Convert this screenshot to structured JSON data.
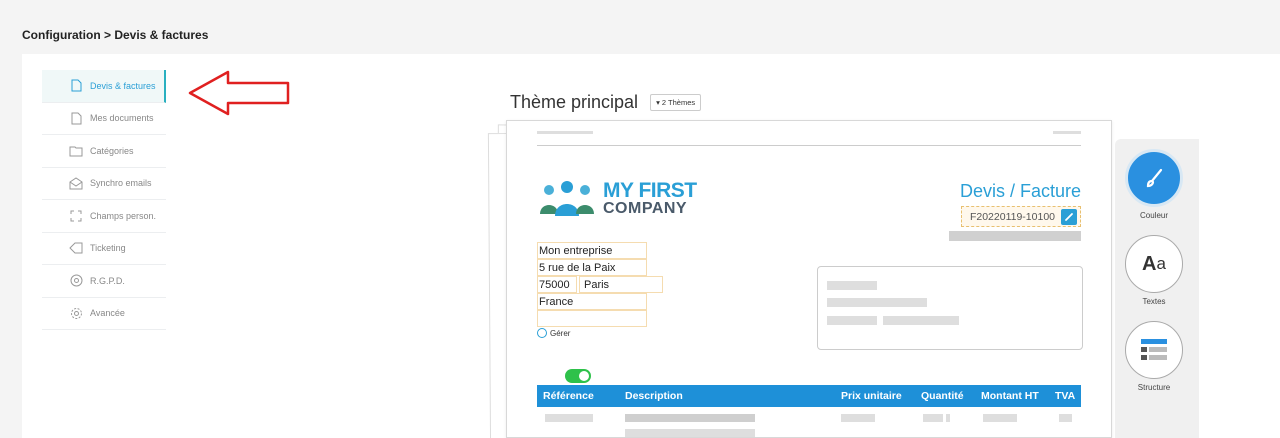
{
  "breadcrumb": "Configuration > Devis & factures",
  "sidebar": {
    "items": [
      {
        "label": "Devis & factures",
        "icon": "document-icon",
        "active": true
      },
      {
        "label": "Mes documents",
        "icon": "document-icon",
        "active": false
      },
      {
        "label": "Catégories",
        "icon": "folder-icon",
        "active": false
      },
      {
        "label": "Synchro emails",
        "icon": "email-icon",
        "active": false
      },
      {
        "label": "Champs person.",
        "icon": "expand-icon",
        "active": false
      },
      {
        "label": "Ticketing",
        "icon": "tag-icon",
        "active": false
      },
      {
        "label": "R.G.P.D.",
        "icon": "shield-icon",
        "active": false
      },
      {
        "label": "Avancée",
        "icon": "gear-icon",
        "active": false
      }
    ]
  },
  "theme": {
    "title": "Thème principal",
    "selector_label": "▾ 2 Thèmes"
  },
  "document": {
    "logo_line1": "MY FIRST",
    "logo_line2": "COMPANY",
    "title": "Devis / Facture",
    "number": "F20220119-10100",
    "company": {
      "name": "Mon entreprise",
      "street": "5 rue de la Paix",
      "zip": "75000",
      "city": "Paris",
      "country": "France"
    },
    "manage_label": "Gérer",
    "table_headers": {
      "reference": "Référence",
      "description": "Description",
      "unit_price": "Prix unitaire",
      "quantity": "Quantité",
      "amount": "Montant HT",
      "vat": "TVA"
    }
  },
  "tools": {
    "color": "Couleur",
    "texts": "Textes",
    "structure": "Structure"
  },
  "colors": {
    "accent": "#2a9fd6",
    "table_header": "#1e90d8",
    "toggle": "#2ec14a",
    "arrow": "#e02020"
  }
}
